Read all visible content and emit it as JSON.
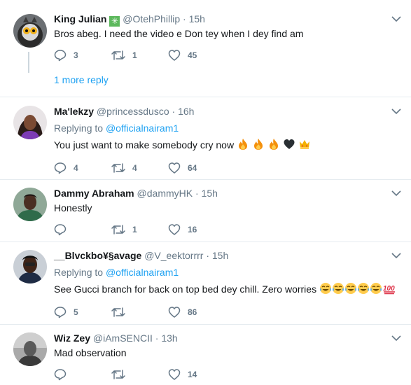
{
  "tweets": [
    {
      "name": "King Julian",
      "name_badge": "✳",
      "handle": "@OtehPhillip",
      "time": "15h",
      "reply_to": "",
      "text": "Bros abeg.  I need the video e Don tey when I dey find am",
      "emoji": [],
      "replies": "3",
      "retweets": "1",
      "likes": "45",
      "more_reply": "1 more reply"
    },
    {
      "name": "Ma'lekzy",
      "handle": "@princessdusco",
      "time": "16h",
      "reply_to_prefix": "Replying to",
      "reply_to": "@officialnairam1",
      "text": "You just want to make somebody cry now",
      "emoji": [
        "fire-emoji",
        "fire-emoji",
        "fire-emoji",
        "black-heart-emoji",
        "crown-emoji"
      ],
      "replies": "4",
      "retweets": "4",
      "likes": "64"
    },
    {
      "name": "Dammy Abraham",
      "handle": "@dammyHK",
      "time": "15h",
      "text": "Honestly",
      "replies": "",
      "retweets": "1",
      "likes": "16"
    },
    {
      "name": "__Blvckbo¥§avage",
      "handle": "@V_eektorrrr",
      "time": "15h",
      "reply_to_prefix": "Replying to",
      "reply_to": "@officialnairam1",
      "text": "See Gucci branch for back on top bed dey chill. Zero worries",
      "emoji": [
        "joy-emoji",
        "joy-emoji",
        "joy-emoji",
        "joy-emoji",
        "joy-emoji",
        "hundred-points-emoji"
      ],
      "replies": "5",
      "retweets": "",
      "likes": "86"
    },
    {
      "name": "Wiz Zey",
      "handle": "@iAmSENCII",
      "time": "13h",
      "text": "Mad observation",
      "replies": "",
      "retweets": "",
      "likes": "14"
    }
  ],
  "colors": {
    "link": "#1da1f2",
    "muted": "#657786",
    "text": "#14171a",
    "divider": "#e6ecf0",
    "thread_line": "#ccd6dd"
  },
  "separator_dot": "·"
}
